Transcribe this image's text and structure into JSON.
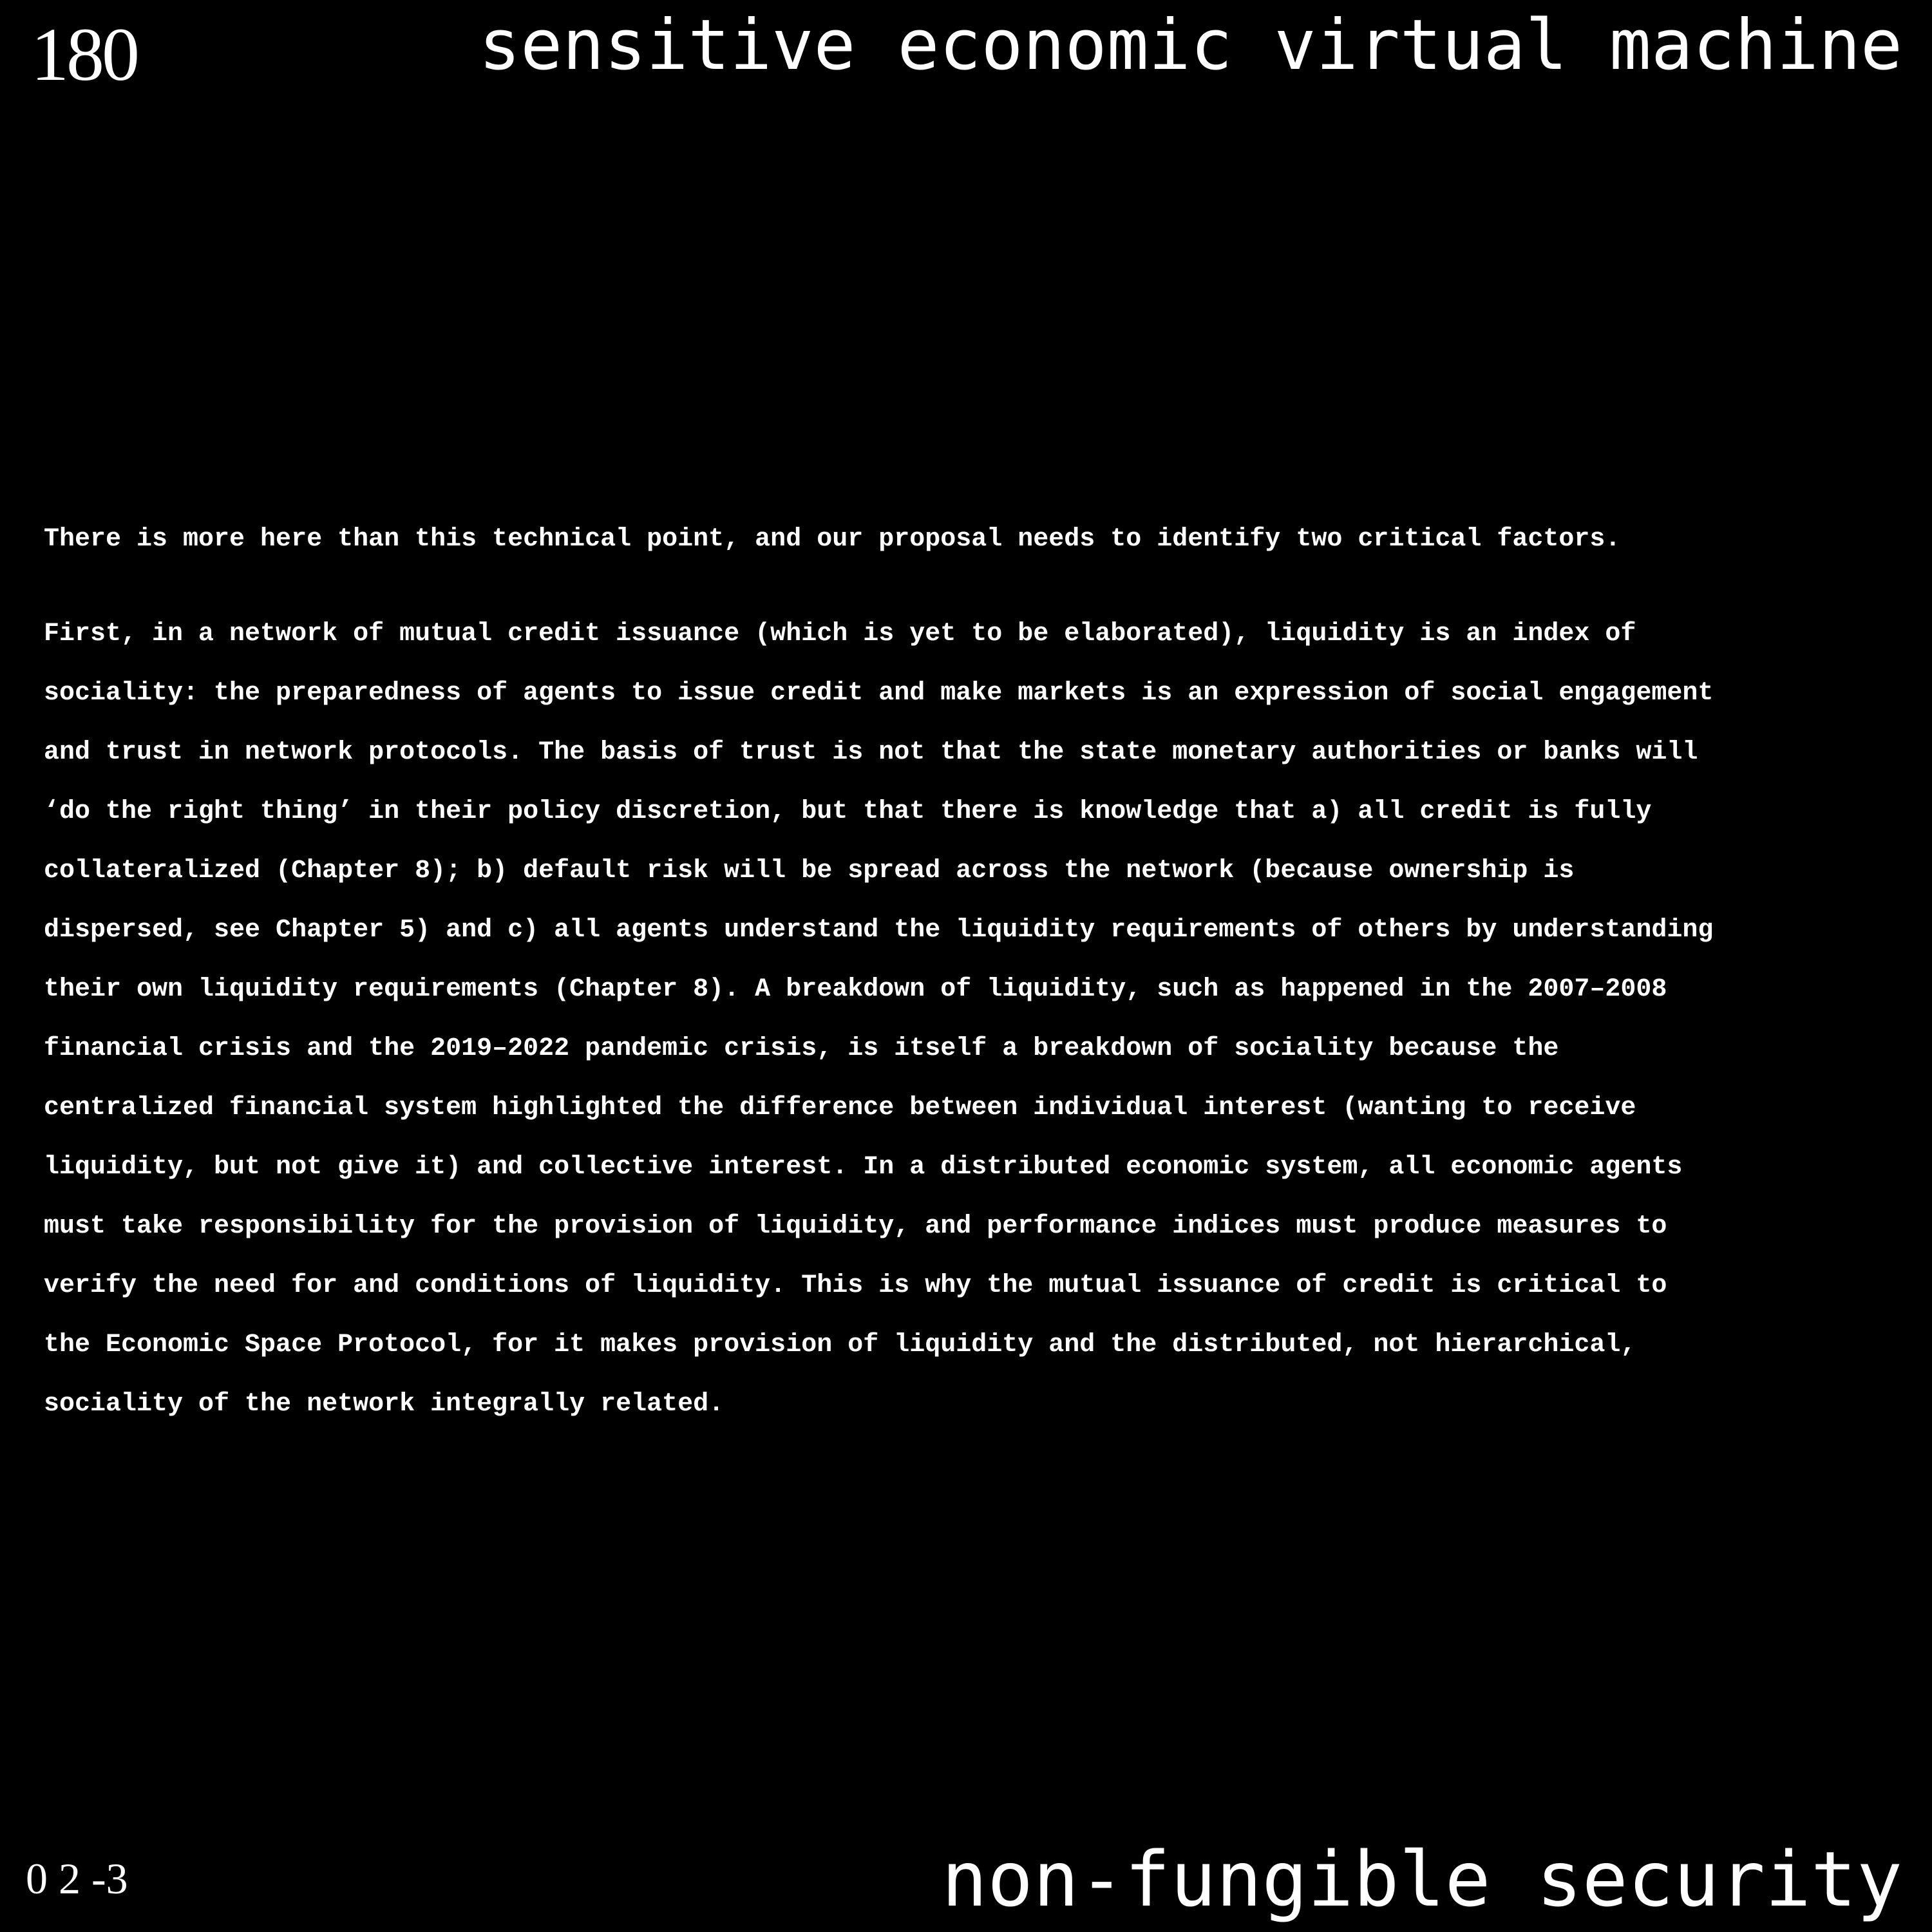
{
  "header": {
    "page_number": "180",
    "running_title": "sensitive economic virtual machine"
  },
  "body": {
    "paragraph_1": "There is more here than this technical point, and our proposal needs to identify two critical factors.",
    "paragraph_2_lines": [
      "First, in a network of mutual credit issuance (which is yet to be elaborated), liquidity is an index of",
      "sociality: the preparedness of agents to issue credit and make markets is an expression of social engagement",
      "and trust in network protocols. The basis of trust is not that the state monetary authorities or banks will",
      "‘do the right thing’ in their policy discretion, but that there is knowledge that a) all credit is fully",
      "collateralized (Chapter 8); b) default risk will be spread across the network (because ownership is",
      "dispersed, see Chapter 5) and c) all agents understand the liquidity requirements of others by understanding",
      "their own liquidity requirements (Chapter 8). A breakdown of liquidity, such as happened in the 2007–2008",
      "financial crisis and the 2019–2022 pandemic crisis, is itself a breakdown of sociality because the",
      "centralized financial system highlighted the difference between individual interest (wanting to receive",
      "liquidity, but not give it) and collective interest. In a distributed economic system, all economic agents",
      "must take responsibility for the provision of liquidity, and performance indices must produce measures to",
      "verify the need for and conditions of liquidity. This is why the mutual issuance of credit is critical to",
      "the Economic Space Protocol, for it makes provision of liquidity and the distributed, not hierarchical,",
      "sociality of the network integrally related."
    ]
  },
  "footer": {
    "code_marker": "0 2 -3",
    "section_title": "non-fungible security"
  }
}
